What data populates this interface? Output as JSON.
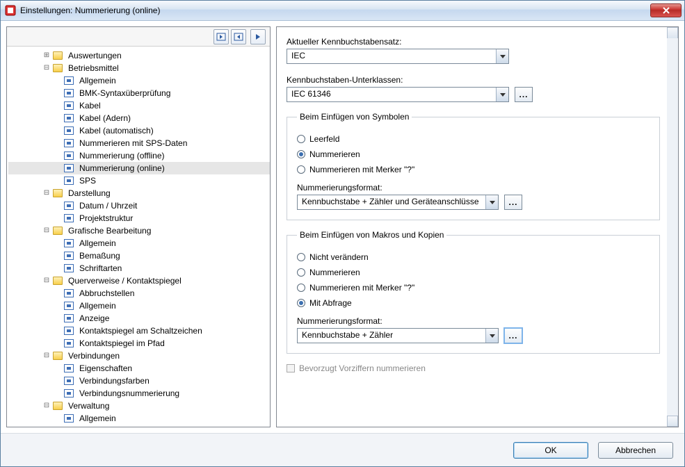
{
  "window": {
    "title": "Einstellungen: Nummerierung (online)"
  },
  "tree": {
    "items": [
      {
        "depth": 3,
        "exp": "plus",
        "icon": "folder",
        "label": "Auswertungen"
      },
      {
        "depth": 3,
        "exp": "minus",
        "icon": "folder",
        "label": "Betriebsmittel"
      },
      {
        "depth": 4,
        "exp": "none",
        "icon": "item",
        "label": "Allgemein"
      },
      {
        "depth": 4,
        "exp": "none",
        "icon": "item",
        "label": "BMK-Syntaxüberprüfung"
      },
      {
        "depth": 4,
        "exp": "none",
        "icon": "item",
        "label": "Kabel"
      },
      {
        "depth": 4,
        "exp": "none",
        "icon": "item",
        "label": "Kabel (Adern)"
      },
      {
        "depth": 4,
        "exp": "none",
        "icon": "item",
        "label": "Kabel (automatisch)"
      },
      {
        "depth": 4,
        "exp": "none",
        "icon": "item",
        "label": "Nummerieren mit SPS-Daten"
      },
      {
        "depth": 4,
        "exp": "none",
        "icon": "item",
        "label": "Nummerierung (offline)"
      },
      {
        "depth": 4,
        "exp": "none",
        "icon": "item",
        "label": "Nummerierung (online)",
        "selected": true
      },
      {
        "depth": 4,
        "exp": "none",
        "icon": "item",
        "label": "SPS"
      },
      {
        "depth": 3,
        "exp": "minus",
        "icon": "folder",
        "label": "Darstellung"
      },
      {
        "depth": 4,
        "exp": "none",
        "icon": "item",
        "label": "Datum / Uhrzeit"
      },
      {
        "depth": 4,
        "exp": "none",
        "icon": "item",
        "label": "Projektstruktur"
      },
      {
        "depth": 3,
        "exp": "minus",
        "icon": "folder",
        "label": "Grafische Bearbeitung"
      },
      {
        "depth": 4,
        "exp": "none",
        "icon": "item",
        "label": "Allgemein"
      },
      {
        "depth": 4,
        "exp": "none",
        "icon": "item",
        "label": "Bemaßung"
      },
      {
        "depth": 4,
        "exp": "none",
        "icon": "item",
        "label": "Schriftarten"
      },
      {
        "depth": 3,
        "exp": "minus",
        "icon": "folder",
        "label": "Querverweise / Kontaktspiegel"
      },
      {
        "depth": 4,
        "exp": "none",
        "icon": "item",
        "label": "Abbruchstellen"
      },
      {
        "depth": 4,
        "exp": "none",
        "icon": "item",
        "label": "Allgemein"
      },
      {
        "depth": 4,
        "exp": "none",
        "icon": "item",
        "label": "Anzeige"
      },
      {
        "depth": 4,
        "exp": "none",
        "icon": "item",
        "label": "Kontaktspiegel am Schaltzeichen"
      },
      {
        "depth": 4,
        "exp": "none",
        "icon": "item",
        "label": "Kontaktspiegel im Pfad"
      },
      {
        "depth": 3,
        "exp": "minus",
        "icon": "folder",
        "label": "Verbindungen"
      },
      {
        "depth": 4,
        "exp": "none",
        "icon": "item",
        "label": "Eigenschaften"
      },
      {
        "depth": 4,
        "exp": "none",
        "icon": "item",
        "label": "Verbindungsfarben"
      },
      {
        "depth": 4,
        "exp": "none",
        "icon": "item",
        "label": "Verbindungsnummerierung"
      },
      {
        "depth": 3,
        "exp": "minus",
        "icon": "folder",
        "label": "Verwaltung"
      },
      {
        "depth": 4,
        "exp": "none",
        "icon": "item",
        "label": "Allgemein"
      }
    ]
  },
  "form": {
    "current_set_label": "Aktueller Kennbuchstabensatz:",
    "current_set_value": "IEC",
    "subclass_label": "Kennbuchstaben-Unterklassen:",
    "subclass_value": "IEC 61346",
    "group_symbols": {
      "legend": "Beim Einfügen von Symbolen",
      "opt_empty": "Leerfeld",
      "opt_number": "Nummerieren",
      "opt_marker": "Nummerieren mit Merker \"?\"",
      "format_label": "Nummerierungsformat:",
      "format_value": "Kennbuchstabe + Zähler und Geräteanschlüsse"
    },
    "group_macros": {
      "legend": "Beim Einfügen von Makros und Kopien",
      "opt_nochange": "Nicht verändern",
      "opt_number": "Nummerieren",
      "opt_marker": "Nummerieren mit Merker \"?\"",
      "opt_ask": "Mit Abfrage",
      "format_label": "Nummerierungsformat:",
      "format_value": "Kennbuchstabe + Zähler"
    },
    "prefer_prefix": "Bevorzugt Vorziffern nummerieren"
  },
  "footer": {
    "ok": "OK",
    "cancel": "Abbrechen"
  }
}
